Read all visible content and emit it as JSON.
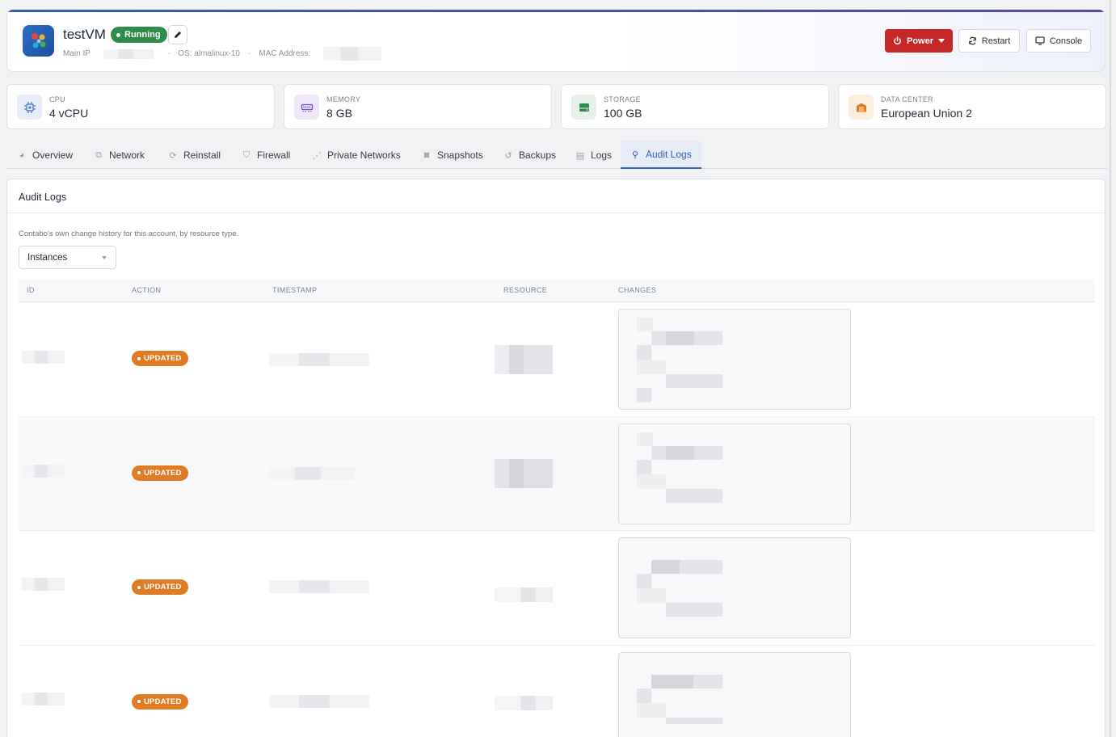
{
  "header": {
    "vm_name": "testVM",
    "status": "Running",
    "main_ip_label": "Main IP",
    "os_label": "OS: almalinux-10",
    "mac_label": "MAC Address:",
    "separator": "·",
    "buttons": {
      "power": "Power",
      "restart": "Restart",
      "console": "Console"
    }
  },
  "stats": [
    {
      "label": "CPU",
      "value": "4 vCPU",
      "icon": "cpu-icon",
      "color": "#4a78c8"
    },
    {
      "label": "MEMORY",
      "value": "8 GB",
      "icon": "memory-icon",
      "color": "#7a4fc4"
    },
    {
      "label": "STORAGE",
      "value": "100 GB",
      "icon": "storage-icon",
      "color": "#2f8b4a"
    },
    {
      "label": "DATA CENTER",
      "value": "European Union 2",
      "icon": "datacenter-icon",
      "color": "#e07b26"
    }
  ],
  "tabs": [
    {
      "label": "Overview",
      "icon": "overview-icon"
    },
    {
      "label": "Network",
      "icon": "network-icon"
    },
    {
      "label": "Reinstall",
      "icon": "reinstall-icon"
    },
    {
      "label": "Firewall",
      "icon": "firewall-icon"
    },
    {
      "label": "Private Networks",
      "icon": "private-networks-icon"
    },
    {
      "label": "Snapshots",
      "icon": "camera-icon"
    },
    {
      "label": "Backups",
      "icon": "history-icon"
    },
    {
      "label": "Logs",
      "icon": "logs-icon"
    },
    {
      "label": "Audit Logs",
      "icon": "search-icon",
      "active": true
    }
  ],
  "audit": {
    "title": "Audit Logs",
    "description": "Contabo's own change history for this account, by resource type.",
    "filter_value": "Instances",
    "columns": [
      "ID",
      "ACTION",
      "TIMESTAMP",
      "RESOURCE",
      "CHANGES"
    ],
    "rows": [
      {
        "action": "UPDATED"
      },
      {
        "action": "UPDATED"
      },
      {
        "action": "UPDATED"
      },
      {
        "action": "UPDATED"
      }
    ],
    "trailing_brace": "}"
  },
  "colors": {
    "accent": "#2f5fb8",
    "power": "#c62828",
    "running": "#2f8b4a",
    "updated": "#e07b26"
  }
}
